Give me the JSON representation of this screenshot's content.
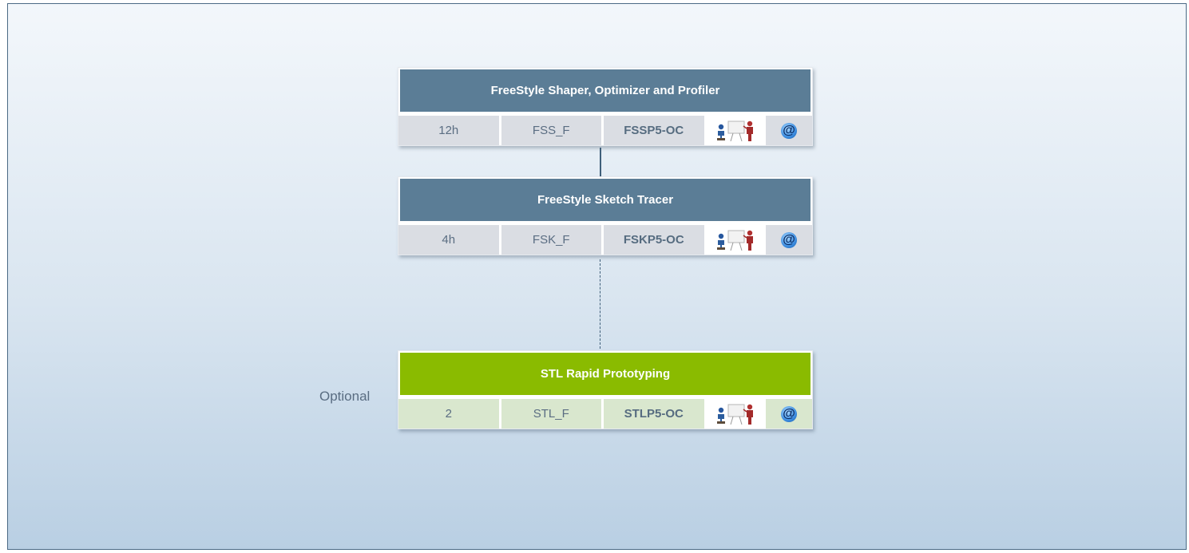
{
  "diagram": {
    "side_label": "Optional",
    "courses": [
      {
        "title": "FreeStyle Shaper, Optimizer and Profiler",
        "duration": "12h",
        "code": "FSS_F",
        "course_id": "FSSP5-OC",
        "icons": [
          "instructor-led-training-icon",
          "e-learning-at-icon"
        ],
        "color": "#5b7d96",
        "link_to_next": "solid"
      },
      {
        "title": "FreeStyle Sketch Tracer",
        "duration": "4h",
        "code": "FSK_F",
        "course_id": "FSKP5-OC",
        "icons": [
          "instructor-led-training-icon",
          "e-learning-at-icon"
        ],
        "color": "#5b7d96",
        "link_to_next": "dashed"
      },
      {
        "title": "STL Rapid Prototyping",
        "duration": "2",
        "code": "STL_F",
        "course_id": "STLP5-OC",
        "icons": [
          "instructor-led-training-icon",
          "e-learning-at-icon"
        ],
        "color": "#8abb00",
        "optional": true
      }
    ],
    "at_symbol": "@"
  }
}
